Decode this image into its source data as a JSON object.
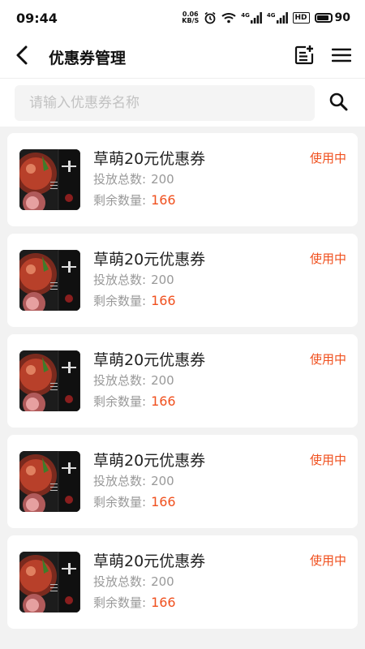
{
  "status_bar": {
    "time": "09:44",
    "net_speed_value": "0.06",
    "net_speed_unit": "KB/S",
    "signal1_label": "4G",
    "signal2_label": "4G",
    "hd_label": "HD",
    "battery": "90"
  },
  "nav": {
    "title": "优惠券管理",
    "icons": [
      "back-icon",
      "add-note-icon",
      "menu-icon"
    ]
  },
  "search": {
    "placeholder": "请输入优惠券名称",
    "value": ""
  },
  "labels": {
    "total_label": "投放总数:",
    "remaining_label": "剩余数量:"
  },
  "colors": {
    "accent": "#f0501e",
    "muted": "#999999",
    "background": "#f2f2f2"
  },
  "coupons": [
    {
      "name": "草萌20元优惠券",
      "status": "使用中",
      "total": "200",
      "remaining": "166"
    },
    {
      "name": "草萌20元优惠券",
      "status": "使用中",
      "total": "200",
      "remaining": "166"
    },
    {
      "name": "草萌20元优惠券",
      "status": "使用中",
      "total": "200",
      "remaining": "166"
    },
    {
      "name": "草萌20元优惠券",
      "status": "使用中",
      "total": "200",
      "remaining": "166"
    },
    {
      "name": "草萌20元优惠券",
      "status": "使用中",
      "total": "200",
      "remaining": "166"
    }
  ]
}
